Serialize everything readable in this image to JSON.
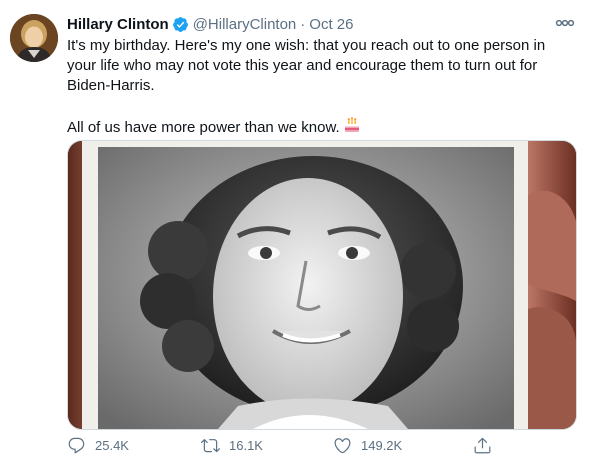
{
  "tweet": {
    "author": {
      "display_name": "Hillary Clinton",
      "handle": "@HillaryClinton",
      "verified": true
    },
    "separator": "·",
    "timestamp": "Oct 26",
    "text_line_1": "It's my birthday. Here's my one wish: that you reach out to one person in your life who may not vote this year and encourage them to turn out for Biden-Harris.",
    "text_line_2": "All of us have more power than we know.",
    "emoji": "birthday-cake",
    "media": {
      "description_icon": "photo"
    },
    "actions": {
      "replies": "25.4K",
      "retweets": "16.1K",
      "likes": "149.2K"
    }
  },
  "icons": {
    "more": "more-horizontal-icon",
    "reply": "reply-icon",
    "retweet": "retweet-icon",
    "like": "heart-icon",
    "share": "share-icon",
    "verified": "verified-badge-icon"
  },
  "colors": {
    "text_primary": "#0f1419",
    "text_secondary": "#5b7083",
    "verified_blue": "#1da1f2",
    "border": "#cfd9de"
  }
}
